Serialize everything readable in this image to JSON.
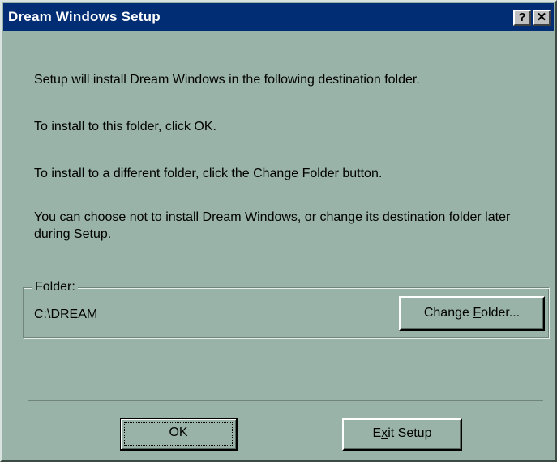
{
  "window": {
    "title": "Dream Windows Setup",
    "help_button": "?",
    "close_button": "✕"
  },
  "instructions": {
    "line1": "Setup will install Dream Windows in the following destination folder.",
    "line2": "To install to this folder, click OK.",
    "line3": "To install to a different folder, click the Change Folder button.",
    "line4": "You can choose not to install Dream Windows, or change its destination folder later during Setup."
  },
  "folder_group": {
    "legend": "Folder:",
    "path": "C:\\DREAM",
    "change_button": {
      "pre": "Change ",
      "accel": "F",
      "post": "older..."
    }
  },
  "buttons": {
    "ok": "OK",
    "exit": {
      "pre": "E",
      "accel": "x",
      "post": "it Setup"
    }
  },
  "colors": {
    "face": "#99b3a9",
    "titlebar": "#002d73",
    "title_text": "#ffffff"
  }
}
